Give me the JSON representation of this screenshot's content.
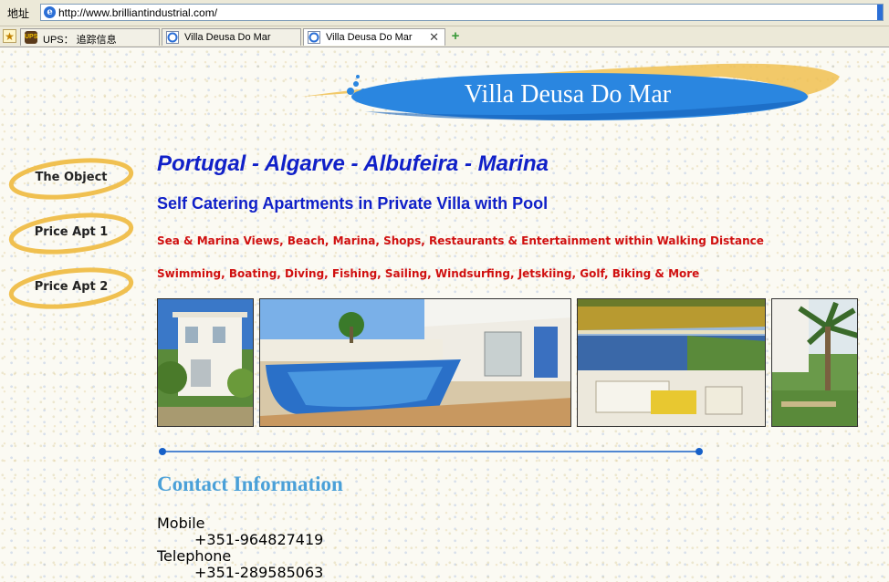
{
  "browser": {
    "address_label": "地址",
    "url": "http://www.brilliantindustrial.com/",
    "tabs": [
      {
        "label": "UPS： 追踪信息",
        "icon": "ups-icon"
      },
      {
        "label": "Villa Deusa Do Mar",
        "icon": "ie-page-icon"
      },
      {
        "label": "Villa Deusa Do Mar",
        "icon": "ie-page-icon",
        "active": true
      }
    ]
  },
  "site": {
    "banner_title": "Villa Deusa Do Mar",
    "colors": {
      "heading_blue": "#1020c8",
      "highlight_red": "#d01010",
      "contact_blue": "#4aa0d8",
      "banner_blue": "#2a86e0",
      "swoosh_gold": "#f0c050"
    }
  },
  "nav": {
    "items": [
      {
        "label": "The Object"
      },
      {
        "label": "Price Apt 1"
      },
      {
        "label": "Price Apt 2"
      }
    ]
  },
  "main": {
    "heading": "Portugal - Algarve - Albufeira - Marina",
    "subheading": "Self Catering Apartments in Private Villa with Pool",
    "highlight_1": "Sea & Marina Views, Beach, Marina, Shops, Restaurants & Entertainment within Walking Distance",
    "highlight_2": "Swimming, Boating, Diving, Fishing, Sailing, Windsurfing, Jetskiing, Golf, Biking & More",
    "photos": [
      "villa-exterior",
      "pool",
      "terrace-sea-view",
      "garden-palm"
    ]
  },
  "contact": {
    "title": "Contact Information",
    "mobile_label": "Mobile",
    "mobile_value": "+351-964827419",
    "telephone_label": "Telephone",
    "telephone_value": "+351-289585063"
  }
}
